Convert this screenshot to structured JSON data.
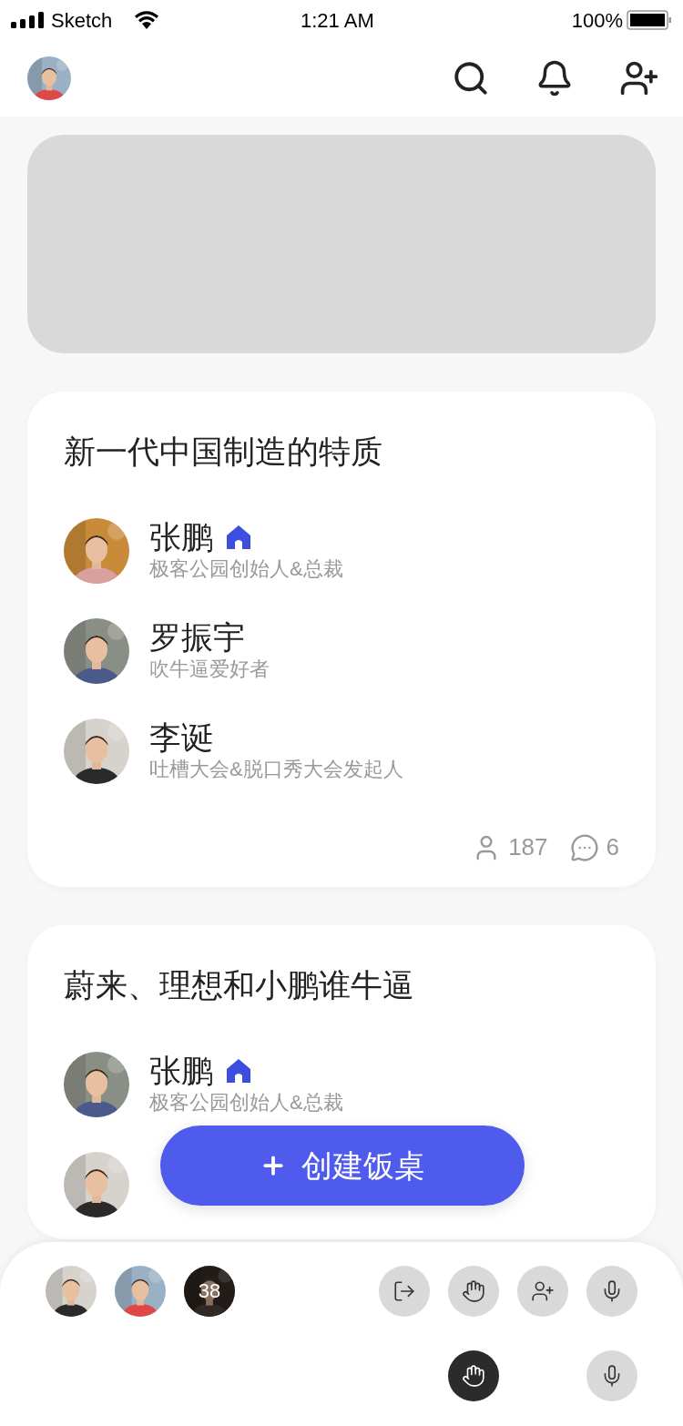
{
  "status_bar": {
    "carrier": "Sketch",
    "time": "1:21 AM",
    "battery": "100%"
  },
  "header": {
    "avatar": {
      "kind": "picture"
    }
  },
  "banner": {
    "kind": "placeholder"
  },
  "rooms": [
    {
      "title": "新一代中国制造的特质",
      "speakers": [
        {
          "name": "张鹏",
          "subtitle": "极客公园创始人&总裁",
          "host": true
        },
        {
          "name": "罗振宇",
          "subtitle": "吹牛逼爱好者",
          "host": false
        },
        {
          "name": "李诞",
          "subtitle": "吐槽大会&脱口秀大会发起人",
          "host": false
        }
      ],
      "listeners": "187",
      "comments": "6"
    },
    {
      "title": "蔚来、理想和小鹏谁牛逼",
      "speakers": [
        {
          "name": "张鹏",
          "subtitle": "极客公园创始人&总裁",
          "host": true
        },
        {
          "host": false
        }
      ]
    }
  ],
  "create_button": {
    "label": "创建饭桌"
  },
  "bottom_bar": {
    "audience": [
      {
        "kind": "picture"
      },
      {
        "kind": "picture"
      },
      {
        "kind": "count",
        "count": "38"
      }
    ],
    "controls": [
      {
        "kind": "leave",
        "active": false
      },
      {
        "kind": "hand",
        "active": false
      },
      {
        "kind": "invite",
        "active": false
      },
      {
        "kind": "mic",
        "active": false
      }
    ],
    "second_row": [
      {
        "kind": "hand",
        "active": true
      },
      {
        "kind": "mic",
        "active": false
      }
    ]
  }
}
